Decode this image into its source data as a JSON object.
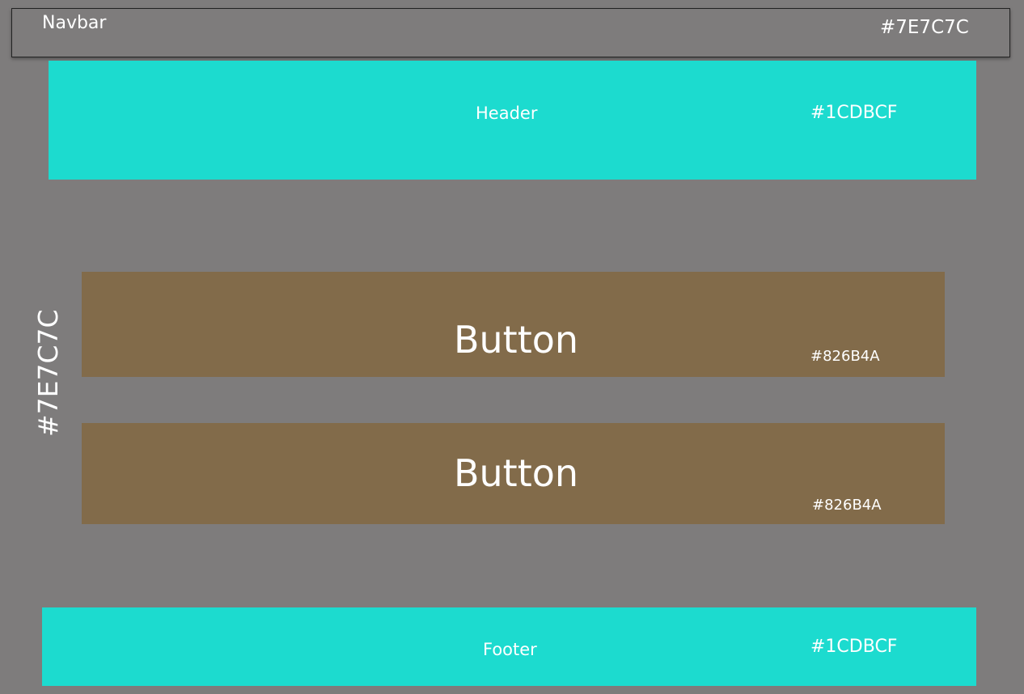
{
  "navbar": {
    "label": "Navbar",
    "color_label": "#7E7C7C",
    "color": "#7E7C7C"
  },
  "header": {
    "label": "Header",
    "color_label": "#1CDBCF",
    "color": "#1CDBCF"
  },
  "page": {
    "background_label": "#7E7C7C",
    "background": "#7E7C7C"
  },
  "buttons": [
    {
      "label": "Button",
      "color_label": "#826B4A",
      "color": "#826B4A"
    },
    {
      "label": "Button",
      "color_label": "#826B4A",
      "color": "#826B4A"
    }
  ],
  "footer": {
    "label": "Footer",
    "color_label": "#1CDBCF",
    "color": "#1CDBCF"
  }
}
